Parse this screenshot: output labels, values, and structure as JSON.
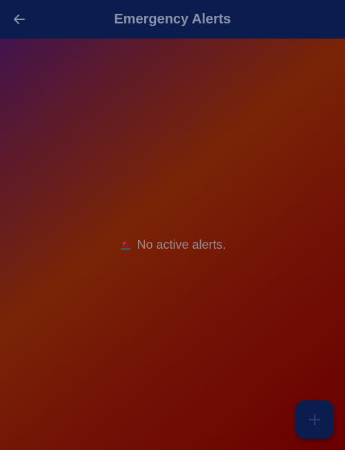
{
  "header": {
    "title": "Emergency Alerts"
  },
  "empty_state": {
    "icon": "siren-icon",
    "message": "No active alerts."
  },
  "fab": {
    "icon": "plus-icon",
    "symbol": "+"
  },
  "colors": {
    "appbar": "#0b1d4e",
    "gradient_start": "#3a1258",
    "gradient_mid": "#7a2406",
    "gradient_end": "#6a0000",
    "title_text": "#8b93a8"
  }
}
